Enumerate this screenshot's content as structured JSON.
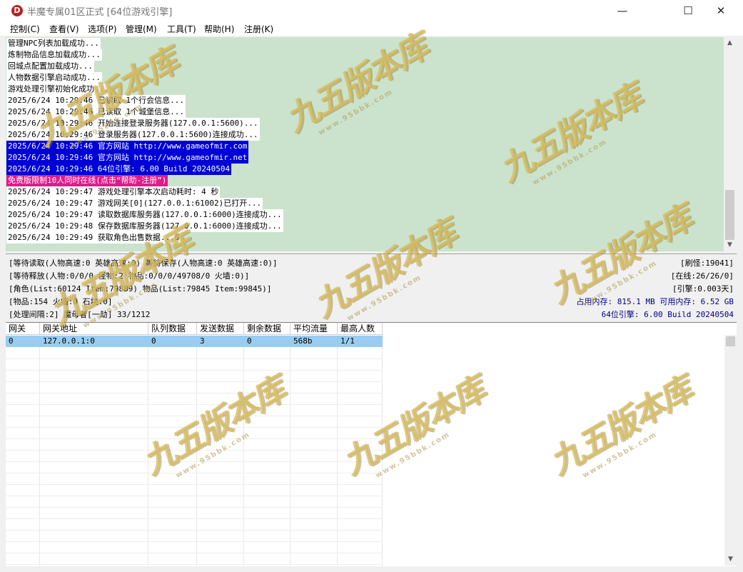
{
  "window": {
    "title": "半魔专属01区正式 [64位游戏引擎]",
    "icon_letter": "D",
    "minimize": "—",
    "maximize": "☐",
    "close": "✕"
  },
  "menu": [
    {
      "label": "控制(C)"
    },
    {
      "label": "查看(V)"
    },
    {
      "label": "选项(P)"
    },
    {
      "label": "管理(M)"
    },
    {
      "label": "工具(T)"
    },
    {
      "label": "帮助(H)"
    },
    {
      "label": "注册(K)"
    }
  ],
  "log": [
    {
      "text": "管理NPC列表加载成功...",
      "style": "white"
    },
    {
      "text": "炼制物品信息加载成功...",
      "style": "white"
    },
    {
      "text": "回城点配置加载成功...",
      "style": "white"
    },
    {
      "text": "人物数据引擎启动成功...",
      "style": "white"
    },
    {
      "text": "游戏处理引擎初始化成功...",
      "style": "white"
    },
    {
      "text": "2025/6/24 10:29:46 已读取 1个行会信息...",
      "style": "white"
    },
    {
      "text": "2025/6/24 10:29:46 已读取 1个城堡信息...",
      "style": "white"
    },
    {
      "text": "2025/6/24 10:29:46 开始连接登录服务器(127.0.0.1:5600)...",
      "style": "white"
    },
    {
      "text": "2025/6/24 10:29:46 登录服务器(127.0.0.1:5600)连接成功...",
      "style": "white"
    },
    {
      "text": "2025/6/24 10:29:46 官方网站 http://www.gameofmir.com",
      "style": "blue"
    },
    {
      "text": "2025/6/24 10:29:46 官方网站 http://www.gameofmir.net",
      "style": "blue"
    },
    {
      "text": "2025/6/24 10:29:46 64位引擎: 6.00 Build 20240504",
      "style": "blue"
    },
    {
      "text": "免费版限制10人同时在线(点击“帮助-注册”)",
      "style": "pink"
    },
    {
      "text": "2025/6/24 10:29:47 游戏处理引擎本次启动耗时: 4 秒",
      "style": "white"
    },
    {
      "text": "2025/6/24 10:29:47 游戏网关[0](127.0.0.1:61002)已打开...",
      "style": "white"
    },
    {
      "text": "2025/6/24 10:29:47 读取数据库服务器(127.0.0.1:6000)连接成功...",
      "style": "white"
    },
    {
      "text": "2025/6/24 10:29:48 保存数据库服务器(127.0.0.1:6000)连接成功...",
      "style": "white"
    },
    {
      "text": "2025/6/24 10:29:49 获取角色出售数据...0",
      "style": "white"
    }
  ],
  "status": {
    "left": [
      "[等待读取(人物高速:0 英雄高速:0) 等待保存(人物高速:0 英雄高速:0)]",
      "[等待释放(人物:0/0/0 怪物:2 物品:0/0/0/49708/0 火墙:0)]",
      "[角色(List:60124 Item:79889) 物品(List:79845 Item:99845)]",
      "[物品:154 火墙:0 石块:0]",
      "[处理间隔:2]     魔母者[一劫] 33/1212"
    ],
    "right": [
      "[刷怪:19041]",
      "[在线:26/26/0]",
      "[引擎:0.003天]",
      "占用内存: 815.1 MB 可用内存: 6.52 GB",
      "64位引擎: 6.00 Build 20240504"
    ]
  },
  "grid": {
    "columns": [
      "网关",
      "网关地址",
      "队列数据",
      "发送数据",
      "剩余数据",
      "平均流量",
      "最高人数"
    ],
    "rows": [
      [
        "0",
        "127.0.0.1:0",
        "0",
        "3",
        "0",
        "568b",
        "1/1"
      ]
    ]
  },
  "watermark": {
    "text": "九五版本库",
    "url": "www.95bbk.com"
  },
  "colors": {
    "log_bg": "#cbe3cc",
    "highlight_blue": "#0000d6",
    "highlight_pink": "#e01a8a",
    "selected_row": "#99ccf0"
  }
}
